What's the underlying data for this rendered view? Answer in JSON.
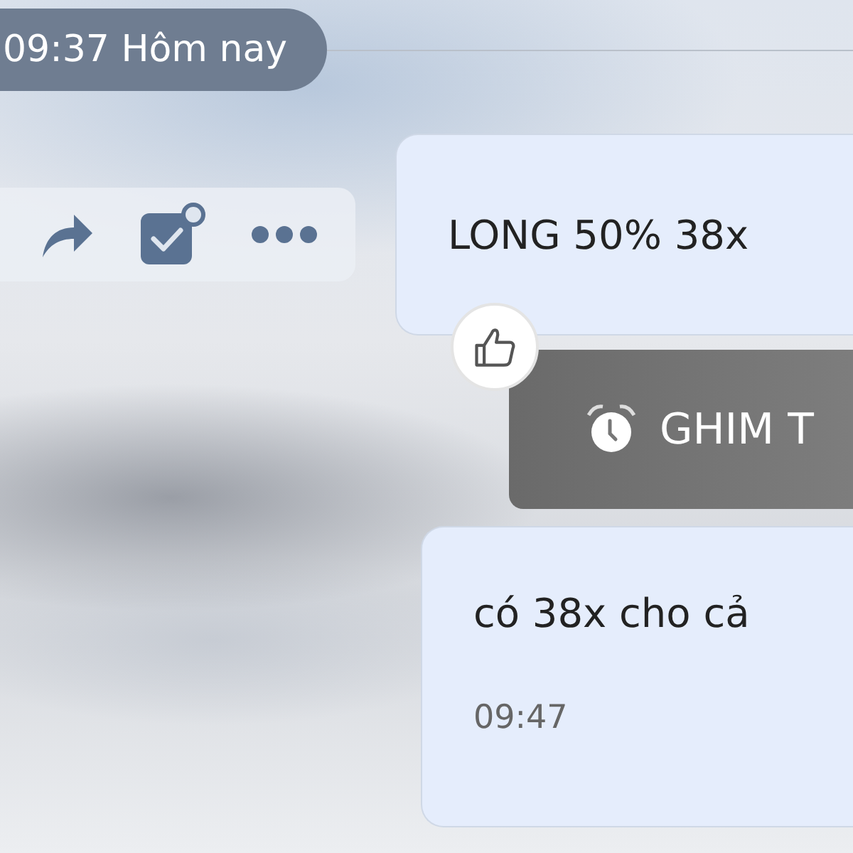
{
  "date_divider": {
    "text": "09:37 Hôm nay"
  },
  "message_actions": [
    {
      "kind": "share"
    },
    {
      "kind": "select"
    },
    {
      "kind": "more"
    }
  ],
  "messages": [
    {
      "kind": "text",
      "text": "LONG 50% 38x",
      "like_button": {
        "liked": false
      }
    },
    {
      "kind": "pin",
      "text": "GHIM T"
    },
    {
      "kind": "text",
      "text": "có 38x cho cả",
      "time": "09:47"
    }
  ]
}
